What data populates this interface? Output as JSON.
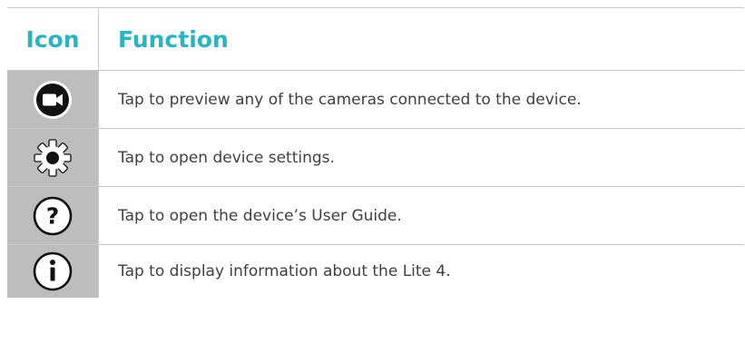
{
  "table": {
    "header": {
      "icon": "Icon",
      "function": "Function"
    },
    "rows": [
      {
        "icon": "video-camera-icon",
        "text": "Tap to preview any of the cameras connected to the device."
      },
      {
        "icon": "gear-icon",
        "text": "Tap to open device settings."
      },
      {
        "icon": "help-icon",
        "text": "Tap to open the device’s User Guide."
      },
      {
        "icon": "info-icon",
        "text": "Tap to display information about the Lite 4."
      }
    ]
  },
  "colors": {
    "header_text": "#2ab3c2",
    "icon_cell_bg": "#bdbdbd",
    "body_text": "#404040",
    "rule": "#c9c9c9"
  }
}
